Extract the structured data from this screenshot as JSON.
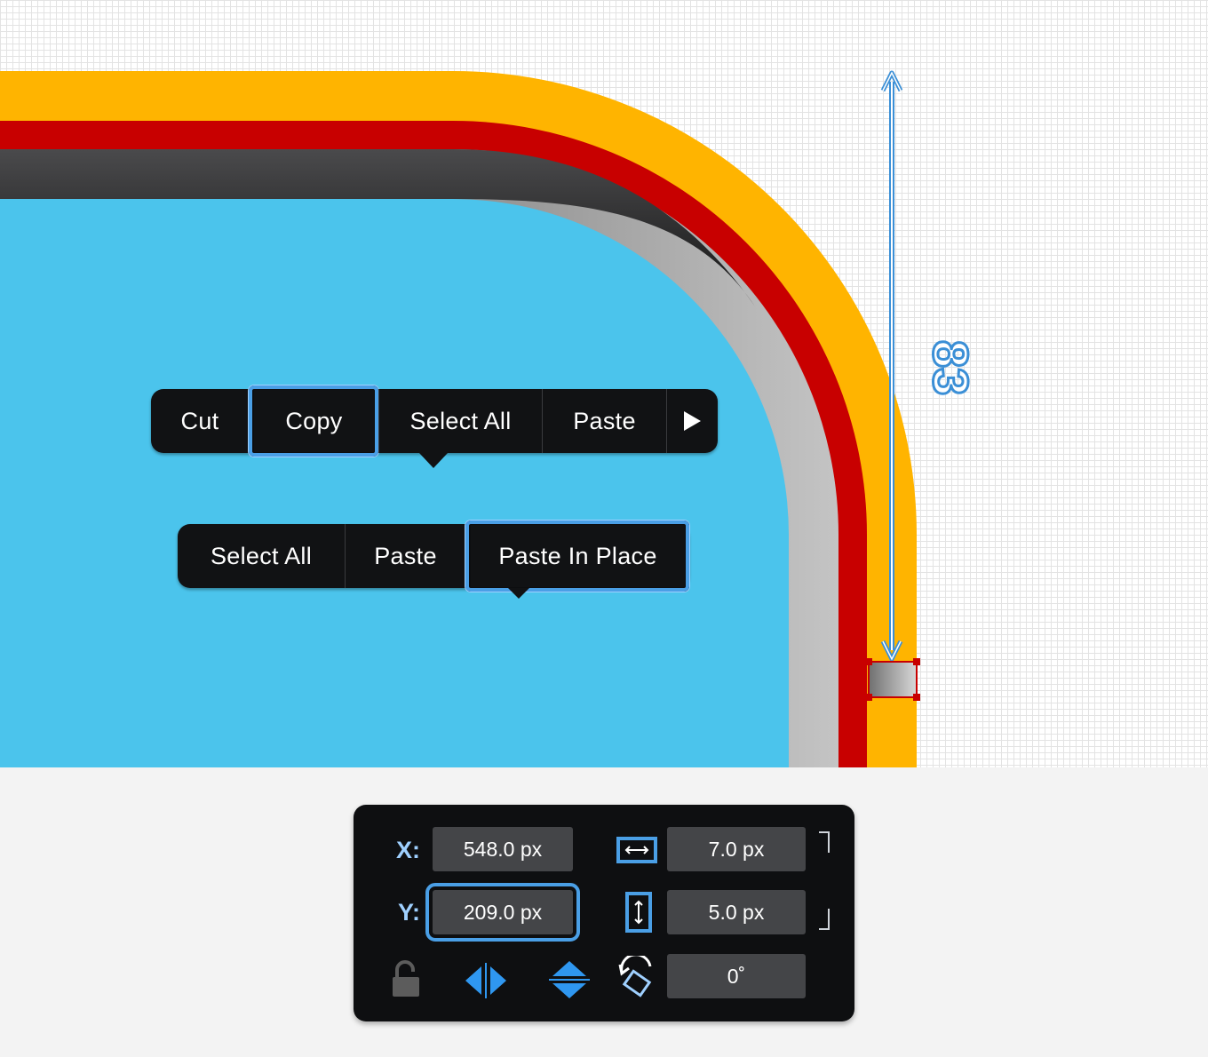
{
  "menu_top": {
    "items": [
      {
        "label": "Cut",
        "selected": false
      },
      {
        "label": "Copy",
        "selected": true
      },
      {
        "label": "Select All",
        "selected": false
      },
      {
        "label": "Paste",
        "selected": false
      }
    ],
    "more_icon": "play-right-icon"
  },
  "menu_bottom": {
    "items": [
      {
        "label": "Select All",
        "selected": false
      },
      {
        "label": "Paste",
        "selected": false
      },
      {
        "label": "Paste In Place",
        "selected": true
      }
    ]
  },
  "dimension": {
    "label": "83"
  },
  "panel": {
    "x_label": "X:",
    "y_label": "Y:",
    "x_value": "548.0 px",
    "y_value": "209.0 px",
    "width_value": "7.0 px",
    "height_value": "5.0 px",
    "rotation_value": "0˚",
    "icons": [
      "lock-open-icon",
      "flip-horizontal-icon",
      "flip-vertical-icon",
      "rotate-icon",
      "width-icon",
      "height-icon"
    ]
  },
  "colors": {
    "orange": "#FFB400",
    "red": "#C80000",
    "sky": "#4BC4EC",
    "accent": "#4A9FE6",
    "menu_bg": "#111214"
  }
}
